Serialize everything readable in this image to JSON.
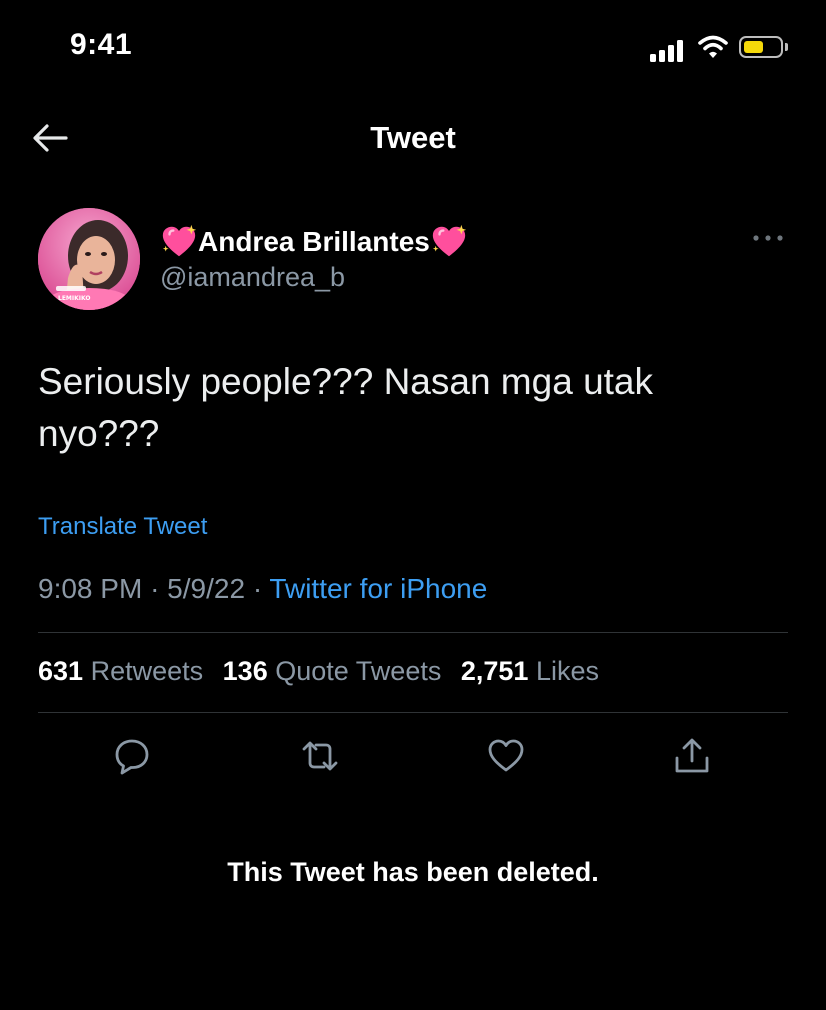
{
  "status_bar": {
    "time": "9:41",
    "battery_level": 0.55,
    "battery_color": "#f5d90a"
  },
  "header": {
    "title": "Tweet",
    "back_icon": "arrow-left-icon"
  },
  "author": {
    "display_name": "Andrea Brillantes",
    "handle": "@iamandrea_b",
    "name_emoji": "sparkling-heart-icon",
    "avatar_text": [
      "LEMIKIKO"
    ],
    "more_icon": "more-horizontal-icon"
  },
  "tweet": {
    "text": "Seriously people??? Nasan mga utak nyo???",
    "translate_label": "Translate Tweet",
    "time": "9:08 PM",
    "date": "5/9/22",
    "separator": "·",
    "source": "Twitter for iPhone"
  },
  "stats": {
    "retweets_count": "631",
    "retweets_label": "Retweets",
    "quotes_count": "136",
    "quotes_label": "Quote Tweets",
    "likes_count": "2,751",
    "likes_label": "Likes"
  },
  "actions": [
    {
      "name": "reply",
      "icon": "reply-icon"
    },
    {
      "name": "retweet",
      "icon": "retweet-icon"
    },
    {
      "name": "like",
      "icon": "heart-icon"
    },
    {
      "name": "share",
      "icon": "share-icon"
    }
  ],
  "notice": "This Tweet has been deleted.",
  "colors": {
    "background": "#000000",
    "link": "#3d9ef2",
    "secondary_text": "#8b98a5",
    "divider": "#2f3336",
    "heart_pink": "#ff4f9d"
  }
}
